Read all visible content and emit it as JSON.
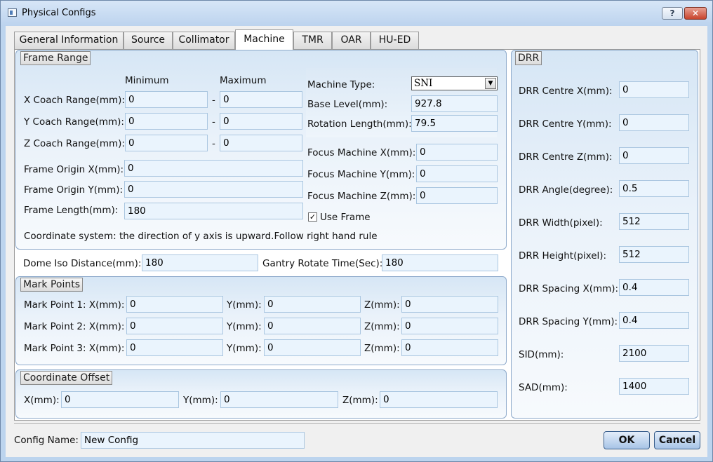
{
  "window": {
    "title": "Physical Configs",
    "help_label": "?",
    "close_label": "✕"
  },
  "tabs": [
    "General Information",
    "Source",
    "Collimator",
    "Machine",
    "TMR",
    "OAR",
    "HU-ED"
  ],
  "frame_range": {
    "title": "Frame Range",
    "min_header": "Minimum",
    "max_header": "Maximum",
    "dash": "-",
    "rows": [
      {
        "label": "X Coach Range(mm):",
        "min": "0",
        "max": "0"
      },
      {
        "label": "Y Coach Range(mm):",
        "min": "0",
        "max": "0"
      },
      {
        "label": "Z Coach Range(mm):",
        "min": "0",
        "max": "0"
      }
    ],
    "origin_x_label": "Frame Origin X(mm):",
    "origin_x": "0",
    "origin_y_label": "Frame Origin Y(mm):",
    "origin_y": "0",
    "length_label": "Frame Length(mm):",
    "length": "180",
    "machine_type_label": "Machine Type:",
    "machine_type": "SNI",
    "base_level_label": "Base Level(mm):",
    "base_level": "927.8",
    "rotation_length_label": "Rotation Length(mm):",
    "rotation_length": "79.5",
    "focus_x_label": "Focus Machine X(mm):",
    "focus_x": "0",
    "focus_y_label": "Focus Machine Y(mm):",
    "focus_y": "0",
    "focus_z_label": "Focus Machine Z(mm):",
    "focus_z": "0",
    "use_frame_label": "Use Frame",
    "use_frame_checked": "✓",
    "note": "Coordinate system: the direction of y axis is upward.Follow right hand rule"
  },
  "dome": {
    "iso_label": "Dome Iso Distance(mm):",
    "iso_value": "180",
    "gantry_label": "Gantry Rotate Time(Sec):",
    "gantry_value": "180"
  },
  "mark_points": {
    "title": "Mark Points",
    "rows": [
      {
        "label": "Mark Point 1: X(mm):",
        "x": "0",
        "y_label": "Y(mm):",
        "y": "0",
        "z_label": "Z(mm):",
        "z": "0"
      },
      {
        "label": "Mark Point 2: X(mm):",
        "x": "0",
        "y_label": "Y(mm):",
        "y": "0",
        "z_label": "Z(mm):",
        "z": "0"
      },
      {
        "label": "Mark Point 3: X(mm):",
        "x": "0",
        "y_label": "Y(mm):",
        "y": "0",
        "z_label": "Z(mm):",
        "z": "0"
      }
    ]
  },
  "coordinate_offset": {
    "title": "Coordinate Offset",
    "x_label": "X(mm):",
    "x": "0",
    "y_label": "Y(mm):",
    "y": "0",
    "z_label": "Z(mm):",
    "z": "0"
  },
  "drr": {
    "title": "DRR",
    "fields": [
      {
        "label": "DRR Centre X(mm):",
        "value": "0"
      },
      {
        "label": "DRR Centre Y(mm):",
        "value": "0"
      },
      {
        "label": "DRR Centre Z(mm):",
        "value": "0"
      },
      {
        "label": "DRR Angle(degree):",
        "value": "0.5"
      },
      {
        "label": "DRR Width(pixel):",
        "value": "512"
      },
      {
        "label": "DRR Height(pixel):",
        "value": "512"
      },
      {
        "label": "DRR Spacing X(mm):",
        "value": "0.4"
      },
      {
        "label": "DRR Spacing Y(mm):",
        "value": "0.4"
      },
      {
        "label": "SID(mm):",
        "value": "2100"
      },
      {
        "label": "SAD(mm):",
        "value": "1400"
      }
    ]
  },
  "footer": {
    "config_name_label": "Config Name:",
    "config_name": "New Config",
    "ok_label": "OK",
    "cancel_label": "Cancel"
  },
  "colors": {
    "panel_border": "#8eaacb",
    "input_bg": "#eaf4fd",
    "close_button": "#c8442c"
  }
}
